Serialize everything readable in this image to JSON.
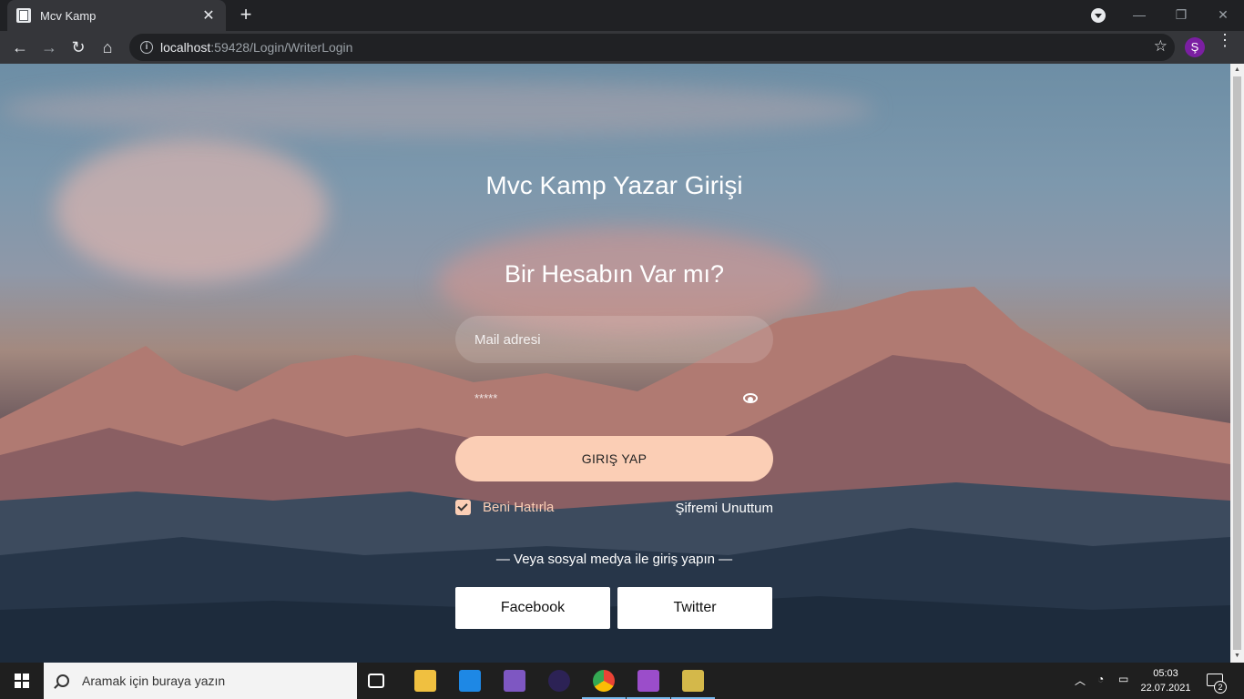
{
  "browser": {
    "tab_title": "Mcv Kamp",
    "tab_close": "✕",
    "new_tab": "+",
    "url_host": "localhost",
    "url_path": ":59428/Login/WriterLogin",
    "profile_initial": "Ş",
    "nav": {
      "back": "←",
      "forward": "→",
      "reload": "↻",
      "home": "⌂"
    },
    "window_controls": {
      "minimize": "—",
      "restore": "❐",
      "close": "✕"
    },
    "star": "☆",
    "menu": "⋮"
  },
  "page": {
    "heading": "Mvc Kamp Yazar Girişi",
    "subheading": "Bir Hesabın Var mı?",
    "mail_placeholder": "Mail adresi",
    "password_masked": "*****",
    "login_button": "GIRIŞ YAP",
    "remember_label": "Beni Hatırla",
    "remember_checked": true,
    "forgot_link": "Şifremi Unuttum",
    "social_text": "— Veya sosyal medya ile giriş yapın —",
    "facebook_button": "Facebook",
    "twitter_button": "Twitter",
    "accent_color": "#fbceb5"
  },
  "taskbar": {
    "search_placeholder": "Aramak için buraya yazın",
    "time": "05:03",
    "date": "22.07.2021",
    "notification_count": "2",
    "apps": [
      "task-view-icon",
      "file-explorer-icon",
      "mail-icon",
      "visual-studio-icon",
      "eclipse-icon",
      "chrome-icon",
      "visual-studio-preview-icon",
      "app-icon"
    ]
  }
}
